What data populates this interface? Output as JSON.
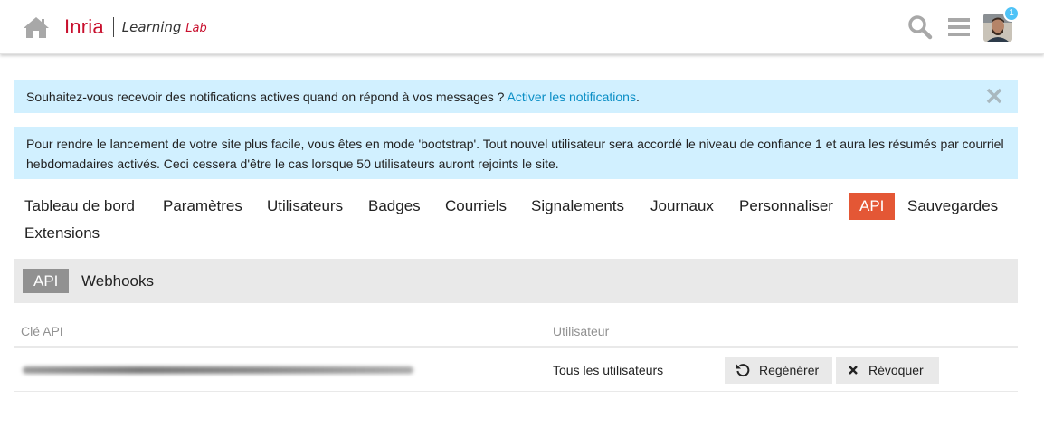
{
  "header": {
    "logo_brand": "Inria",
    "logo_sub": "Learning",
    "logo_sub_lab": "Lab",
    "notification_count": "1"
  },
  "alerts": {
    "notifications_text": "Souhaitez-vous recevoir des notifications actives quand on répond à vos messages ? ",
    "notifications_link": "Activer les notifications",
    "notifications_end": ".",
    "bootstrap_text": "Pour rendre le lancement de votre site plus facile, vous êtes en mode 'bootstrap'. Tout nouvel utilisateur sera accordé le niveau de confiance 1 et aura les résumés par courriel hebdomadaires activés. Ceci cessera d'être le cas lorsque 50 utilisateurs auront rejoints le site."
  },
  "nav": {
    "items": [
      {
        "label": "Tableau de bord"
      },
      {
        "label": "Paramètres"
      },
      {
        "label": "Utilisateurs"
      },
      {
        "label": "Badges"
      },
      {
        "label": "Courriels"
      },
      {
        "label": "Signalements"
      },
      {
        "label": "Journaux"
      },
      {
        "label": "Personnaliser"
      },
      {
        "label": "API"
      },
      {
        "label": "Sauvegardes"
      },
      {
        "label": "Extensions"
      }
    ],
    "active": "API"
  },
  "subnav": {
    "items": [
      {
        "label": "API"
      },
      {
        "label": "Webhooks"
      }
    ],
    "active": "API"
  },
  "table": {
    "headers": {
      "key": "Clé API",
      "user": "Utilisateur"
    },
    "rows": [
      {
        "user": "Tous les utilisateurs",
        "regen_label": "Regénérer",
        "revoke_label": "Révoquer"
      }
    ]
  },
  "colors": {
    "accent": "#e45735",
    "alert_bg": "#d1f0ff",
    "link": "#0a8ec5",
    "brand": "#c8102e"
  }
}
